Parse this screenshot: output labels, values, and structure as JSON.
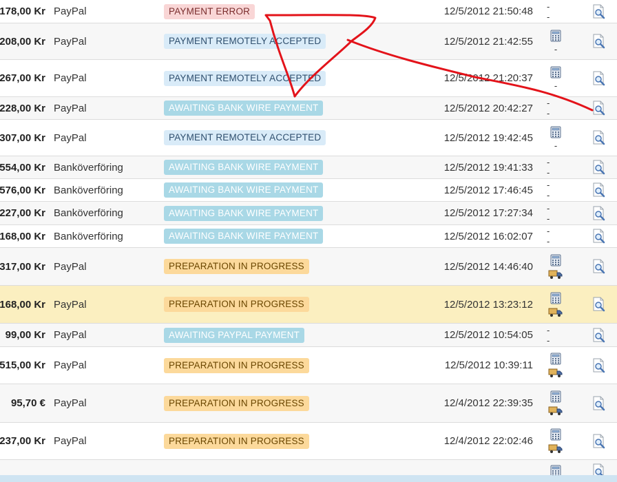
{
  "orders": [
    {
      "amount": "178,00 Kr",
      "payment": "PayPal",
      "status": "PAYMENT ERROR",
      "status_type": "error",
      "date": "12/5/2012 21:50:48",
      "invoice": false,
      "delivery": false,
      "actions_text": "- -",
      "row": "even"
    },
    {
      "amount": "208,00 Kr",
      "payment": "PayPal",
      "status": "PAYMENT REMOTELY ACCEPTED",
      "status_type": "accepted",
      "date": "12/5/2012 21:42:55",
      "invoice": true,
      "delivery": false,
      "actions_text": "-",
      "row": "odd"
    },
    {
      "amount": "267,00 Kr",
      "payment": "PayPal",
      "status": "PAYMENT REMOTELY ACCEPTED",
      "status_type": "accepted",
      "date": "12/5/2012 21:20:37",
      "invoice": true,
      "delivery": false,
      "actions_text": "-",
      "row": "even"
    },
    {
      "amount": "228,00 Kr",
      "payment": "PayPal",
      "status": "AWAITING BANK WIRE PAYMENT",
      "status_type": "bankwire",
      "date": "12/5/2012 20:42:27",
      "invoice": false,
      "delivery": false,
      "actions_text": "- -",
      "row": "odd"
    },
    {
      "amount": "307,00 Kr",
      "payment": "PayPal",
      "status": "PAYMENT REMOTELY ACCEPTED",
      "status_type": "accepted",
      "date": "12/5/2012 19:42:45",
      "invoice": true,
      "delivery": false,
      "actions_text": "-",
      "row": "even"
    },
    {
      "amount": "554,00 Kr",
      "payment": "Banköverföring",
      "status": "AWAITING BANK WIRE PAYMENT",
      "status_type": "bankwire",
      "date": "12/5/2012 19:41:33",
      "invoice": false,
      "delivery": false,
      "actions_text": "- -",
      "row": "odd"
    },
    {
      "amount": "576,00 Kr",
      "payment": "Banköverföring",
      "status": "AWAITING BANK WIRE PAYMENT",
      "status_type": "bankwire",
      "date": "12/5/2012 17:46:45",
      "invoice": false,
      "delivery": false,
      "actions_text": "- -",
      "row": "even"
    },
    {
      "amount": "227,00 Kr",
      "payment": "Banköverföring",
      "status": "AWAITING BANK WIRE PAYMENT",
      "status_type": "bankwire",
      "date": "12/5/2012 17:27:34",
      "invoice": false,
      "delivery": false,
      "actions_text": "- -",
      "row": "odd"
    },
    {
      "amount": "168,00 Kr",
      "payment": "Banköverföring",
      "status": "AWAITING BANK WIRE PAYMENT",
      "status_type": "bankwire",
      "date": "12/5/2012 16:02:07",
      "invoice": false,
      "delivery": false,
      "actions_text": "- -",
      "row": "even"
    },
    {
      "amount": "317,00 Kr",
      "payment": "PayPal",
      "status": "PREPARATION IN PROGRESS",
      "status_type": "prep",
      "date": "12/5/2012 14:46:40",
      "invoice": true,
      "delivery": true,
      "actions_text": "",
      "row": "odd"
    },
    {
      "amount": "168,00 Kr",
      "payment": "PayPal",
      "status": "PREPARATION IN PROGRESS",
      "status_type": "prep",
      "date": "12/5/2012 13:23:12",
      "invoice": true,
      "delivery": true,
      "actions_text": "",
      "row": "highlight"
    },
    {
      "amount": "99,00 Kr",
      "payment": "PayPal",
      "status": "AWAITING PAYPAL PAYMENT",
      "status_type": "paypal",
      "date": "12/5/2012 10:54:05",
      "invoice": false,
      "delivery": false,
      "actions_text": "- -",
      "row": "odd"
    },
    {
      "amount": "515,00 Kr",
      "payment": "PayPal",
      "status": "PREPARATION IN PROGRESS",
      "status_type": "prep",
      "date": "12/5/2012 10:39:11",
      "invoice": true,
      "delivery": true,
      "actions_text": "",
      "row": "even"
    },
    {
      "amount": "95,70 €",
      "payment": "PayPal",
      "status": "PREPARATION IN PROGRESS",
      "status_type": "prep",
      "date": "12/4/2012 22:39:35",
      "invoice": true,
      "delivery": true,
      "actions_text": "",
      "row": "odd"
    },
    {
      "amount": "237,00 Kr",
      "payment": "PayPal",
      "status": "PREPARATION IN PROGRESS",
      "status_type": "prep",
      "date": "12/4/2012 22:02:46",
      "invoice": true,
      "delivery": true,
      "actions_text": "",
      "row": "even"
    },
    {
      "amount": "",
      "payment": "",
      "status": "",
      "status_type": "prep",
      "date": "",
      "invoice": true,
      "delivery": false,
      "actions_text": "",
      "row": "odd"
    }
  ],
  "colors": {
    "error_badge": "#f9d6d6",
    "accepted_badge": "#d9ebf8",
    "bankwire_badge": "#a9d8e6",
    "prep_badge": "#fcd99b",
    "highlight_row": "#fbefc0",
    "annotation": "#e3131a"
  },
  "icons": {
    "invoice": "calculator-icon",
    "delivery": "truck-icon",
    "view": "magnifier-page-icon"
  },
  "annotation": {
    "type": "hand-drawn-arrow",
    "color": "#e3131a"
  }
}
